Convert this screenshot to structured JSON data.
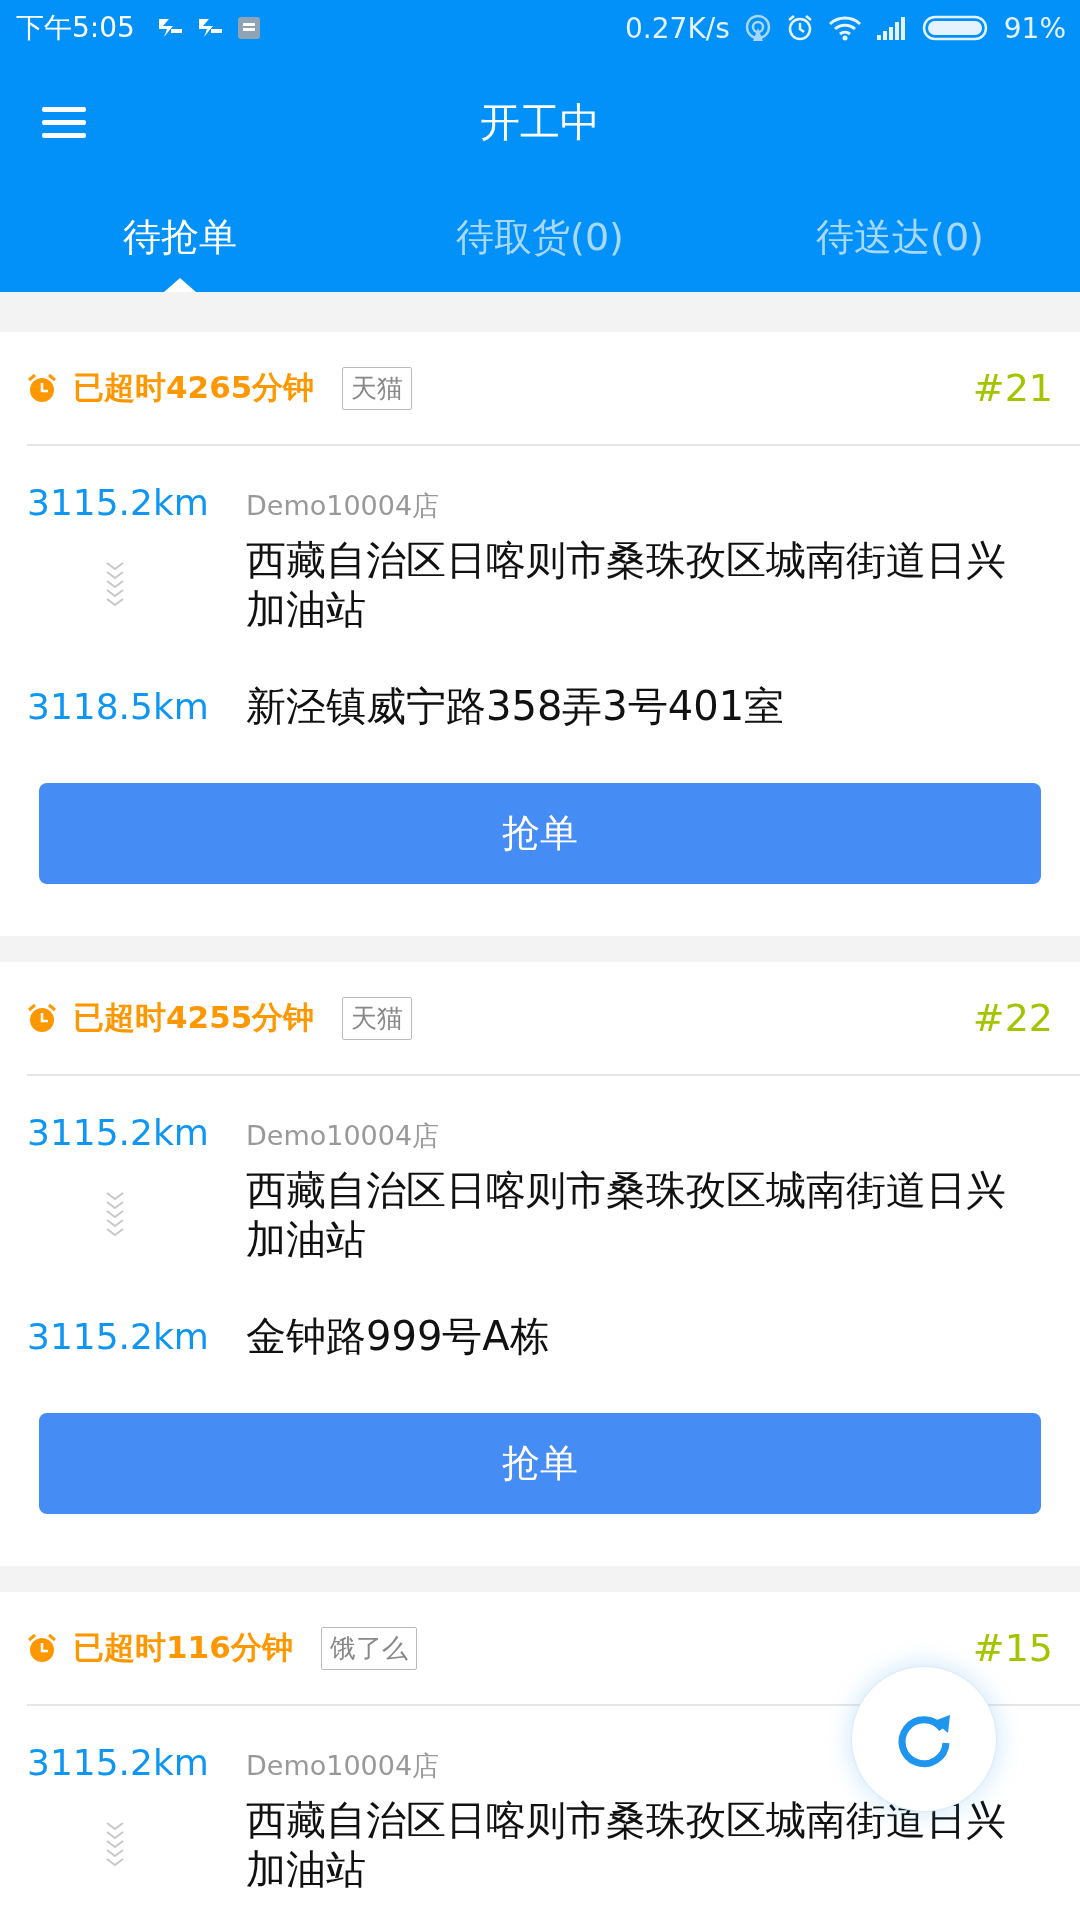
{
  "status_bar": {
    "time": "下午5:05",
    "speed": "0.27K/s",
    "battery": "91%"
  },
  "header": {
    "title": "开工中"
  },
  "tabs": [
    {
      "label": "待抢单",
      "selected": true
    },
    {
      "label": "待取货(0)",
      "selected": false
    },
    {
      "label": "待送达(0)",
      "selected": false
    }
  ],
  "orders": [
    {
      "overdue": "已超时4265分钟",
      "platform": "天猫",
      "number": "#21",
      "pickup_distance": "3115.2km",
      "shop": "Demo10004店",
      "pickup_address": "西藏自治区日喀则市桑珠孜区城南街道日兴加油站",
      "dropoff_distance": "3118.5km",
      "dropoff_address": "新泾镇威宁路358弄3号401室",
      "button": "抢单"
    },
    {
      "overdue": "已超时4255分钟",
      "platform": "天猫",
      "number": "#22",
      "pickup_distance": "3115.2km",
      "shop": "Demo10004店",
      "pickup_address": "西藏自治区日喀则市桑珠孜区城南街道日兴加油站",
      "dropoff_distance": "3115.2km",
      "dropoff_address": "金钟路999号A栋",
      "button": "抢单"
    },
    {
      "overdue": "已超时116分钟",
      "platform": "饿了么",
      "number": "#15",
      "pickup_distance": "3115.2km",
      "shop": "Demo10004店",
      "pickup_address": "西藏自治区日喀则市桑珠孜区城南街道日兴加油站"
    }
  ]
}
